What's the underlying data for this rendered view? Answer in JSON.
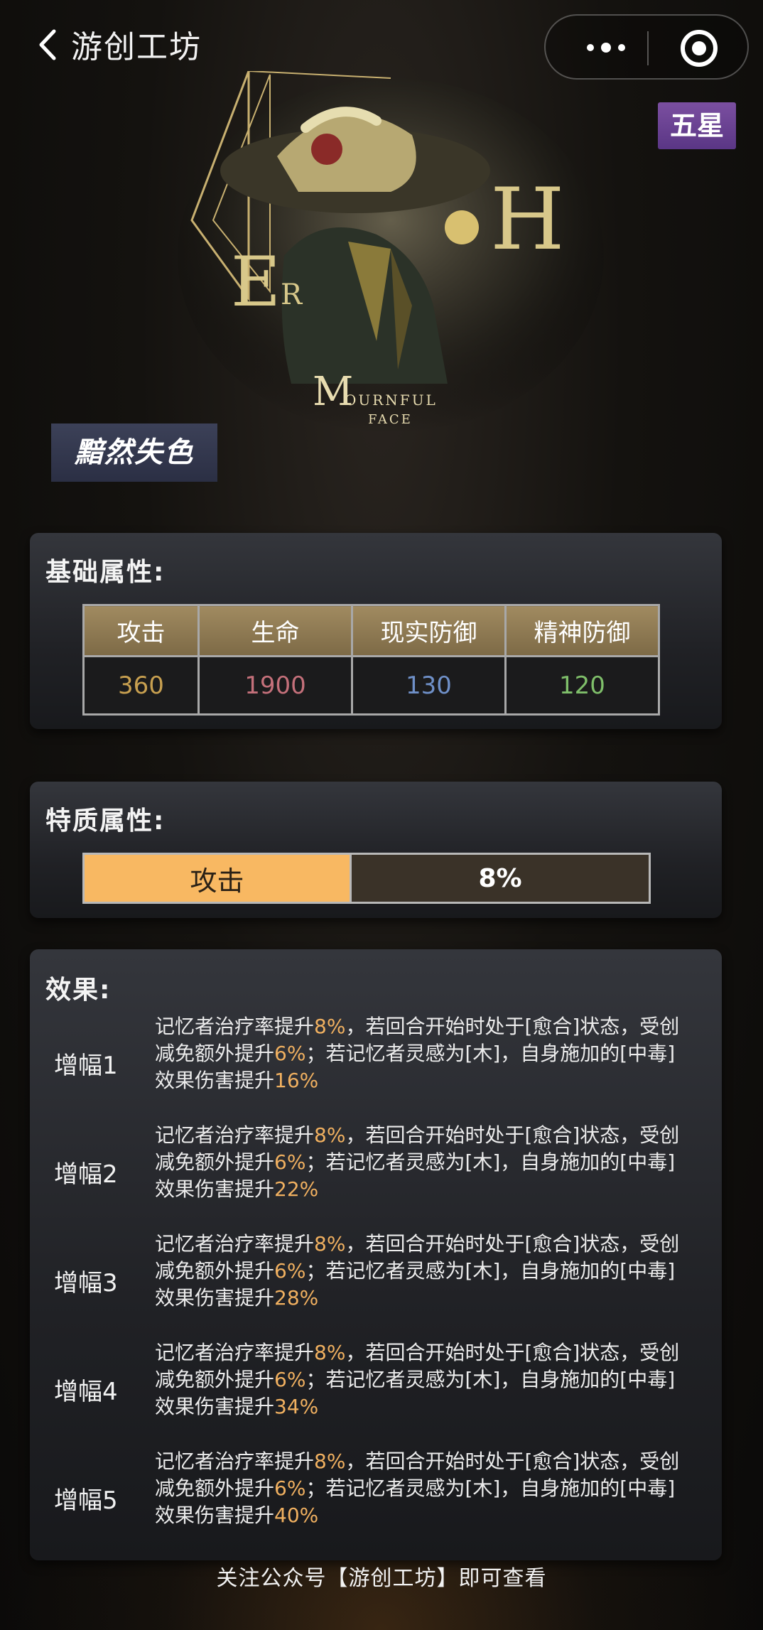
{
  "header": {
    "title": "游创工坊",
    "back_icon": "chevron-left-icon",
    "more_icon": "more-dots-icon",
    "close_icon": "target-circle-icon"
  },
  "card": {
    "rarity": "五星",
    "name": "黯然失色",
    "art_text_big_left": "E",
    "art_text_small": "R",
    "art_text_big_right": "H",
    "art_logo_letter": "M",
    "art_logo_line1": "OURNFUL",
    "art_logo_line2": "FACE"
  },
  "basic": {
    "title": "基础属性:",
    "headers": [
      "攻击",
      "生命",
      "现实防御",
      "精神防御"
    ],
    "values": [
      "360",
      "1900",
      "130",
      "120"
    ],
    "value_colors": [
      "#c8a050",
      "#c4707a",
      "#6f90c8",
      "#7fbf6a"
    ]
  },
  "trait": {
    "title": "特质属性:",
    "attribute": "攻击",
    "value": "8%"
  },
  "effects": {
    "title": "效果:",
    "items": [
      {
        "label": "增幅1",
        "p1": "记忆者治疗率提升",
        "v1": "8%",
        "p2": "，若回合开始时处于[愈合]状态，受创减免额外提升",
        "v2": "6%",
        "p3": "；若记忆者灵感为[木]，自身施加的[中毒]效果伤害提升",
        "v3": "16%"
      },
      {
        "label": "增幅2",
        "p1": "记忆者治疗率提升",
        "v1": "8%",
        "p2": "，若回合开始时处于[愈合]状态，受创减免额外提升",
        "v2": "6%",
        "p3": "；若记忆者灵感为[木]，自身施加的[中毒]效果伤害提升",
        "v3": "22%"
      },
      {
        "label": "增幅3",
        "p1": "记忆者治疗率提升",
        "v1": "8%",
        "p2": "，若回合开始时处于[愈合]状态，受创减免额外提升",
        "v2": "6%",
        "p3": "；若记忆者灵感为[木]，自身施加的[中毒]效果伤害提升",
        "v3": "28%"
      },
      {
        "label": "增幅4",
        "p1": "记忆者治疗率提升",
        "v1": "8%",
        "p2": "，若回合开始时处于[愈合]状态，受创减免额外提升",
        "v2": "6%",
        "p3": "；若记忆者灵感为[木]，自身施加的[中毒]效果伤害提升",
        "v3": "34%"
      },
      {
        "label": "增幅5",
        "p1": "记忆者治疗率提升",
        "v1": "8%",
        "p2": "，若回合开始时处于[愈合]状态，受创减免额外提升",
        "v2": "6%",
        "p3": "；若记忆者灵感为[木]，自身施加的[中毒]效果伤害提升",
        "v3": "40%"
      }
    ]
  },
  "footer": {
    "text": "关注公众号【游创工坊】即可查看"
  }
}
